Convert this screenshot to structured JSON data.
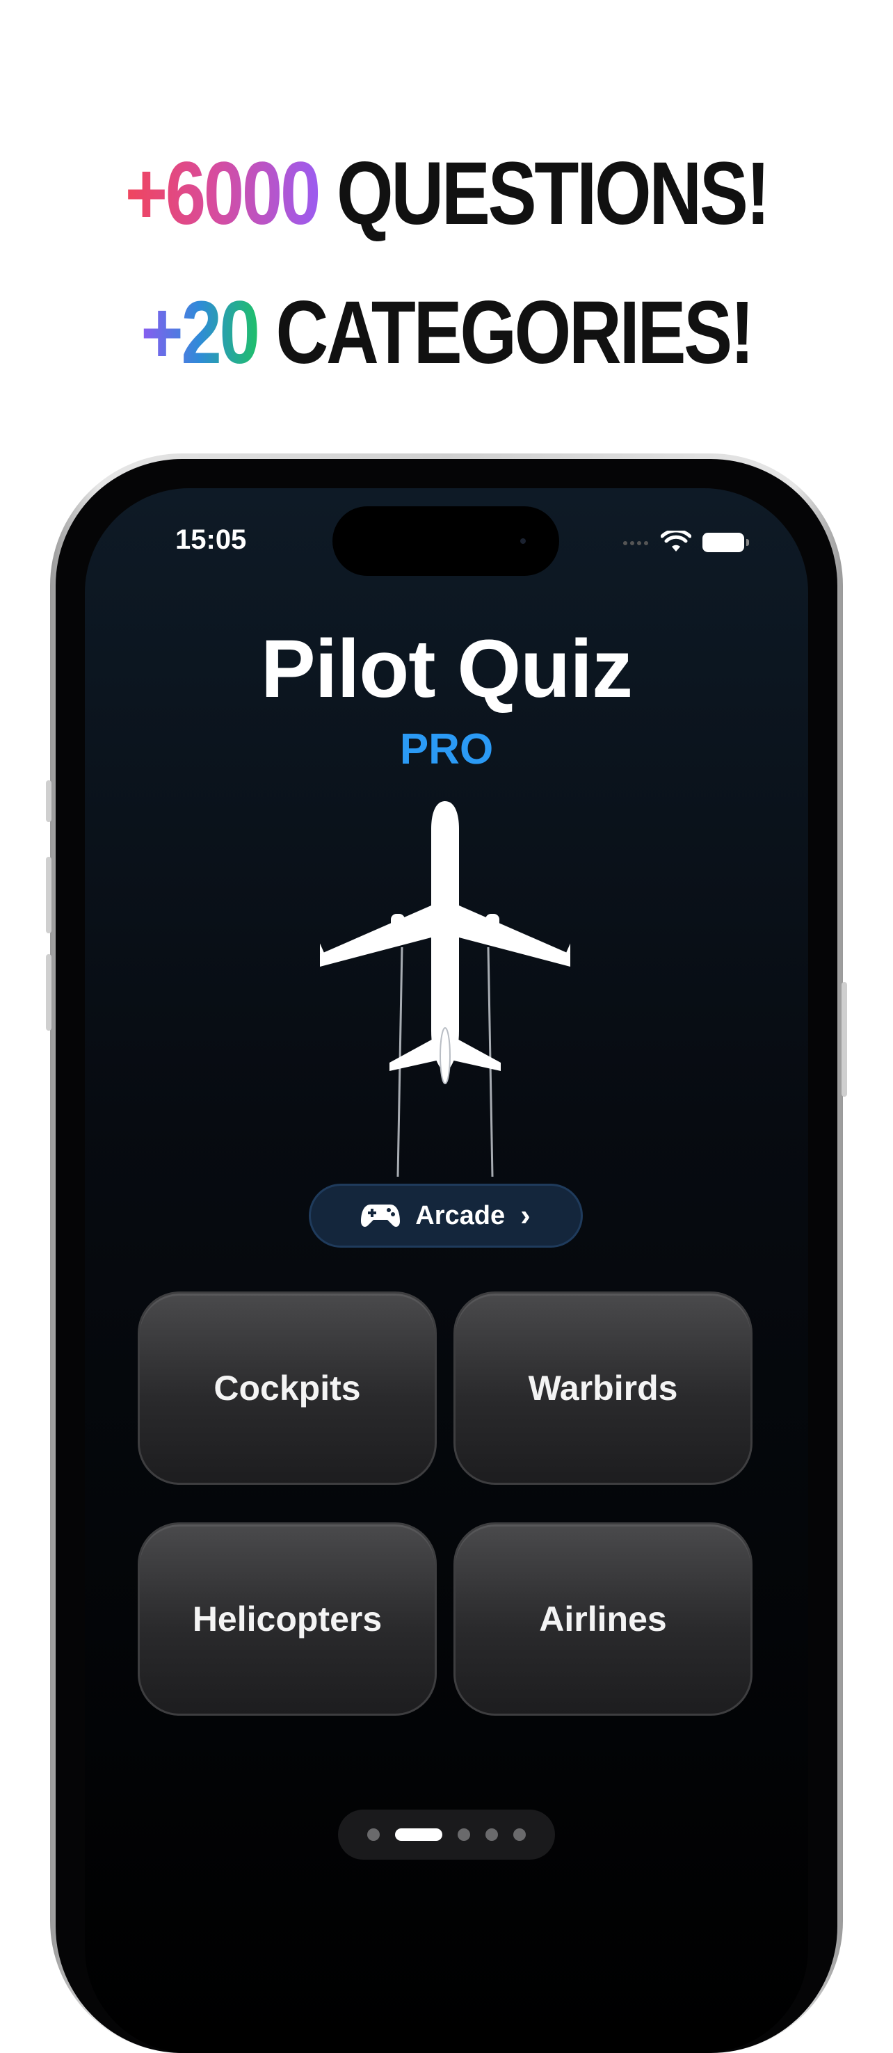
{
  "headline": {
    "line1_count": "+6000",
    "line1_text": " QUESTIONS!",
    "line2_count": "+20",
    "line2_text": " CATEGORIES!"
  },
  "status_bar": {
    "time": "15:05"
  },
  "app": {
    "title": "Pilot Quiz",
    "subtitle": "PRO"
  },
  "arcade": {
    "label": "Arcade",
    "chevron": "›",
    "icon": "gamecontroller-icon"
  },
  "categories": [
    "Cockpits",
    "Warbirds",
    "Helicopters",
    "Airlines"
  ],
  "pager": {
    "total": 5,
    "active_index": 1
  },
  "colors": {
    "accent": "#2b9af5",
    "background": "#000000",
    "arcade_bg": "#14263c"
  }
}
